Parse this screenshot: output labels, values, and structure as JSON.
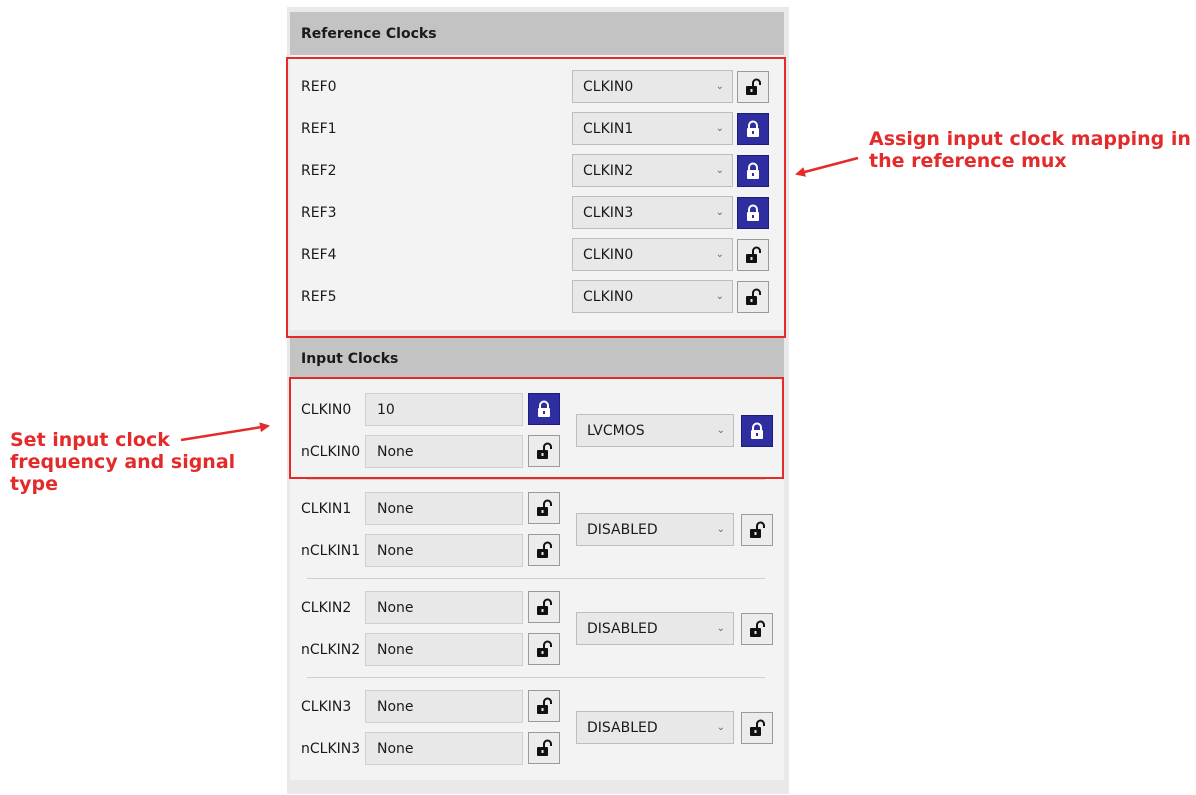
{
  "reference_clocks": {
    "title": "Reference Clocks",
    "rows": [
      {
        "label": "REF0",
        "value": "CLKIN0",
        "locked": false
      },
      {
        "label": "REF1",
        "value": "CLKIN1",
        "locked": true
      },
      {
        "label": "REF2",
        "value": "CLKIN2",
        "locked": true
      },
      {
        "label": "REF3",
        "value": "CLKIN3",
        "locked": true
      },
      {
        "label": "REF4",
        "value": "CLKIN0",
        "locked": false
      },
      {
        "label": "REF5",
        "value": "CLKIN0",
        "locked": false
      }
    ]
  },
  "input_clocks": {
    "title": "Input Clocks",
    "groups": [
      {
        "p_label": "CLKIN0",
        "p_value": "10",
        "p_locked": true,
        "n_label": "nCLKIN0",
        "n_value": "None",
        "n_locked": false,
        "type": "LVCMOS",
        "type_locked": true
      },
      {
        "p_label": "CLKIN1",
        "p_value": "None",
        "p_locked": false,
        "n_label": "nCLKIN1",
        "n_value": "None",
        "n_locked": false,
        "type": "DISABLED",
        "type_locked": false
      },
      {
        "p_label": "CLKIN2",
        "p_value": "None",
        "p_locked": false,
        "n_label": "nCLKIN2",
        "n_value": "None",
        "n_locked": false,
        "type": "DISABLED",
        "type_locked": false
      },
      {
        "p_label": "CLKIN3",
        "p_value": "None",
        "p_locked": false,
        "n_label": "nCLKIN3",
        "n_value": "None",
        "n_locked": false,
        "type": "DISABLED",
        "type_locked": false
      }
    ]
  },
  "annotations": {
    "ref_mux_note_line1": "Assign input clock mapping in",
    "ref_mux_note_line2": "the reference mux",
    "input_note_line1": "Set input clock",
    "input_note_line2": "frequency and signal",
    "input_note_line3": "type"
  },
  "colors": {
    "locked_button": "#2e2ea0",
    "annotation_red": "#e32b2b",
    "header_gray": "#c3c3c3"
  },
  "icons": {
    "chevron": "chevron-down-icon",
    "locked": "lock-closed-icon",
    "unlocked": "lock-open-icon"
  }
}
